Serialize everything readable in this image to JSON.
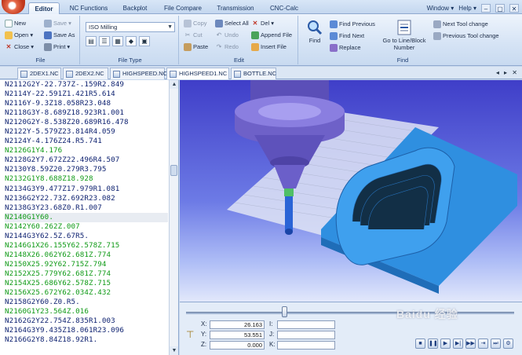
{
  "ribbon_tabs": [
    {
      "label": "Editor",
      "active": true
    },
    {
      "label": "NC Functions"
    },
    {
      "label": "Backplot"
    },
    {
      "label": "File Compare"
    },
    {
      "label": "Transmission"
    },
    {
      "label": "CNC-Calc"
    }
  ],
  "top_right": {
    "window": "Window",
    "help": "Help"
  },
  "file_group": {
    "label": "File",
    "new": "New",
    "open": "Open",
    "close": "Close",
    "save": "Save",
    "save_as": "Save As",
    "print": "Print"
  },
  "filetype_group": {
    "label": "File Type",
    "selected": "ISO Milling"
  },
  "edit_group": {
    "label": "Edit",
    "copy": "Copy",
    "cut": "Cut",
    "paste": "Paste",
    "select_all": "Select All",
    "undo": "Undo",
    "redo": "Redo",
    "del": "Del",
    "append_file": "Append File",
    "insert_file": "Insert File"
  },
  "find_group": {
    "label": "Find",
    "find": "Find",
    "find_previous": "Find Previous",
    "find_next": "Find Next",
    "replace": "Replace",
    "goto_line": "Go to Line/Block Number",
    "next_tool_change": "Next Tool change",
    "previous_tool_change": "Previous Tool change"
  },
  "file_tabs": [
    {
      "name": "2DEX1.NC"
    },
    {
      "name": "2DEX2.NC"
    },
    {
      "name": "HIGHSPEED.NC"
    },
    {
      "name": "HIGHSPEED1.NC",
      "active": true
    },
    {
      "name": "BOTTLE.NC"
    }
  ],
  "nc_lines": [
    {
      "text": "N2112G2Y-22.737Z-.159R2.849",
      "color": "code"
    },
    {
      "text": "N2114Y-22.591Z1.421R5.614",
      "color": "code"
    },
    {
      "text": "N2116Y-9.3Z18.058R23.048",
      "color": "code"
    },
    {
      "text": "N2118G3Y-8.689Z18.923R1.001",
      "color": "code"
    },
    {
      "text": "N2120G2Y-8.538Z20.689R16.478",
      "color": "code"
    },
    {
      "text": "N2122Y-5.579Z23.814R4.059",
      "color": "code"
    },
    {
      "text": "N2124Y-4.176Z24.R5.741",
      "color": "code"
    },
    {
      "text": "N2126G1Y4.176",
      "color": "green"
    },
    {
      "text": "N2128G2Y7.672Z22.496R4.507",
      "color": "code"
    },
    {
      "text": "N2130Y8.59Z20.279R3.795",
      "color": "code"
    },
    {
      "text": "N2132G1Y8.688Z18.928",
      "color": "green"
    },
    {
      "text": "N2134G3Y9.477Z17.979R1.081",
      "color": "code"
    },
    {
      "text": "N2136G2Y22.73Z.692R23.082",
      "color": "code"
    },
    {
      "text": "N2138G3Y23.68Z0.R1.007",
      "color": "code"
    },
    {
      "text": "N2140G1Y60.",
      "color": "green",
      "selected": true
    },
    {
      "text": "N2142Y60.262Z.007",
      "color": "green"
    },
    {
      "text": "N2144G3Y62.5Z.67R5.",
      "color": "code"
    },
    {
      "text": "N2146G1X26.155Y62.578Z.715",
      "color": "green"
    },
    {
      "text": "N2148X26.062Y62.681Z.774",
      "color": "green"
    },
    {
      "text": "N2150X25.92Y62.715Z.794",
      "color": "green"
    },
    {
      "text": "N2152X25.779Y62.681Z.774",
      "color": "green"
    },
    {
      "text": "N2154X25.686Y62.578Z.715",
      "color": "green"
    },
    {
      "text": "N2156X25.672Y62.034Z.432",
      "color": "green"
    },
    {
      "text": "N2158G2Y60.Z0.R5.",
      "color": "code"
    },
    {
      "text": "N2160G1Y23.564Z.016",
      "color": "green"
    },
    {
      "text": "N2162G2Y22.754Z.835R1.003",
      "color": "code"
    },
    {
      "text": "N2164G3Y9.435Z18.061R23.096",
      "color": "code"
    },
    {
      "text": "N2166G2Y8.84Z18.92R1.",
      "color": "code"
    }
  ],
  "coords": {
    "x_label": "X:",
    "x_value": "26.163",
    "y_label": "Y:",
    "y_value": "53.551",
    "z_label": "Z:",
    "z_value": "0.000",
    "i_label": "I:",
    "j_label": "J:",
    "k_label": "K:",
    "i_value": "",
    "j_value": "",
    "k_value": ""
  },
  "playback_position": 0.3,
  "watermark": "Baidu 经验",
  "colors": {
    "code_text": "#0a1e6e",
    "green_text": "#0f9a16",
    "viewport_top": "#3f3ec8",
    "part_blue": "#2f8fe0",
    "spindle_purple": "#6e61c8"
  }
}
